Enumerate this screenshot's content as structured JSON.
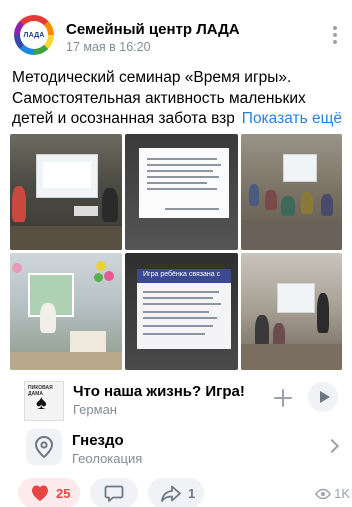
{
  "post": {
    "author": "Семейный центр ЛАДА",
    "date": "17 мая в 16:20",
    "avatar_text": "ЛАДА",
    "text_lines": [
      "Методический семинар «Время игры».",
      "Самостоятельная активность маленьких",
      "детей и осознанная забота взр"
    ],
    "show_more": "Показать ещё"
  },
  "photos": {
    "count": 6,
    "slide_title": "Игра ребёнка связана с"
  },
  "music": {
    "title": "Что наша жизнь? Игра!",
    "artist": "Герман",
    "album_caption": "ПИКОВАЯ ДАМА"
  },
  "geo": {
    "title": "Гнездо",
    "subtitle": "Геолокация"
  },
  "actions": {
    "likes": "25",
    "comments": "",
    "shares": "1",
    "views": "1K"
  },
  "colors": {
    "accent": "#2a81d8",
    "like": "#e64646",
    "secondary_text": "#818c99",
    "pill_bg": "#f0f2f5"
  }
}
